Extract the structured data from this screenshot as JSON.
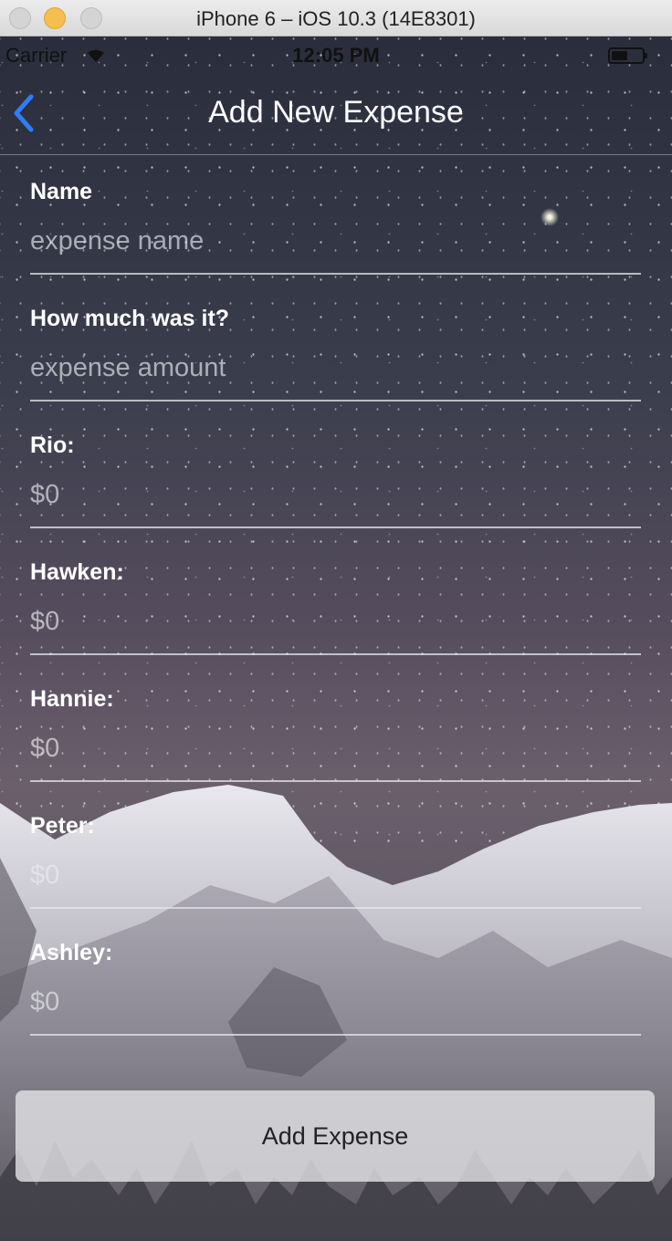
{
  "window": {
    "title": "iPhone 6 – iOS 10.3 (14E8301)"
  },
  "status_bar": {
    "carrier": "Carrier",
    "time": "12:05 PM"
  },
  "nav": {
    "title": "Add New Expense",
    "back_icon": "chevron-left-icon",
    "accent_color": "#2f7cf6"
  },
  "form": {
    "name": {
      "label": "Name",
      "placeholder": "expense name"
    },
    "amount": {
      "label": "How much was it?",
      "placeholder": "expense amount"
    },
    "people": [
      {
        "label": "Rio:",
        "placeholder": "$0"
      },
      {
        "label": "Hawken:",
        "placeholder": "$0"
      },
      {
        "label": "Hannie:",
        "placeholder": "$0"
      },
      {
        "label": "Peter:",
        "placeholder": "$0"
      },
      {
        "label": "Ashley:",
        "placeholder": "$0"
      }
    ]
  },
  "actions": {
    "submit_label": "Add Expense"
  }
}
